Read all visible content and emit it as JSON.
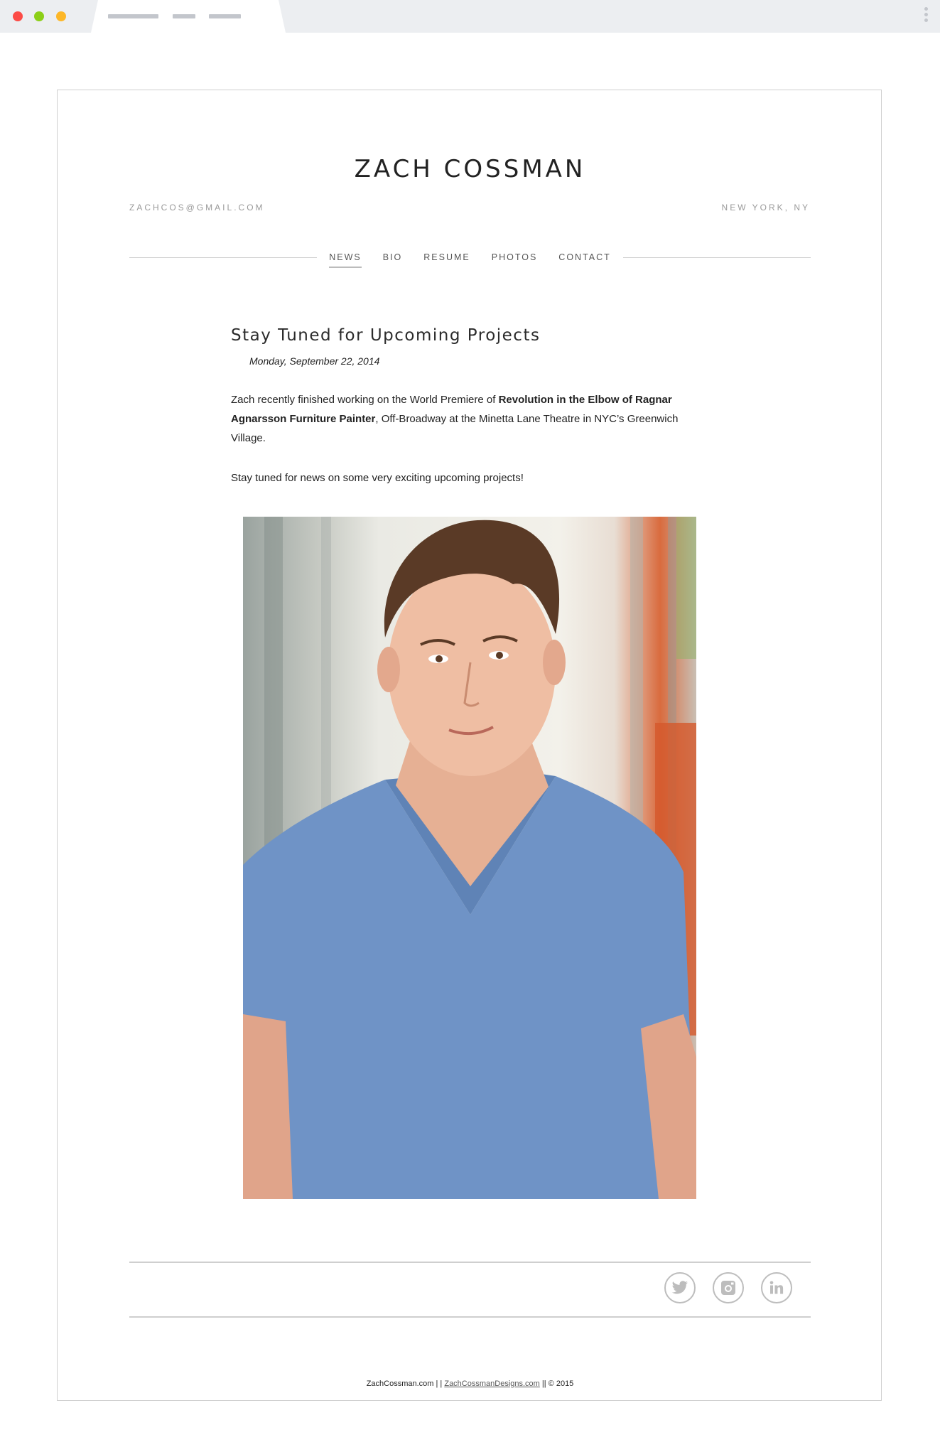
{
  "site": {
    "title": "ZACH COSSMAN",
    "email": "ZACHCOS@GMAIL.COM",
    "location": "NEW YORK, NY"
  },
  "nav": {
    "items": [
      {
        "label": "NEWS",
        "active": true
      },
      {
        "label": "BIO",
        "active": false
      },
      {
        "label": "RESUME",
        "active": false
      },
      {
        "label": "PHOTOS",
        "active": false
      },
      {
        "label": "CONTACT",
        "active": false
      }
    ]
  },
  "post": {
    "title": "Stay Tuned for Upcoming Projects",
    "date": "Monday, September 22, 2014",
    "p1_pre": "Zach recently finished working on the World Premiere of ",
    "p1_bold": "Revolution in the Elbow of Ragnar Agnarsson Furniture Painter",
    "p1_post": ", Off-Broadway at the Minetta Lane Theatre in NYC’s Greenwich Village.",
    "p2": "Stay tuned for news on some very exciting upcoming projects!"
  },
  "social": {
    "icons": [
      "twitter-icon",
      "instagram-icon",
      "linkedin-icon"
    ],
    "color": "#bdbdbd"
  },
  "footer": {
    "site_name": "ZachCossman.com",
    "sep1": " | | ",
    "designer_link": "ZachCossmanDesigns.com",
    "sep2": " || ",
    "copyright": "© 2015"
  }
}
